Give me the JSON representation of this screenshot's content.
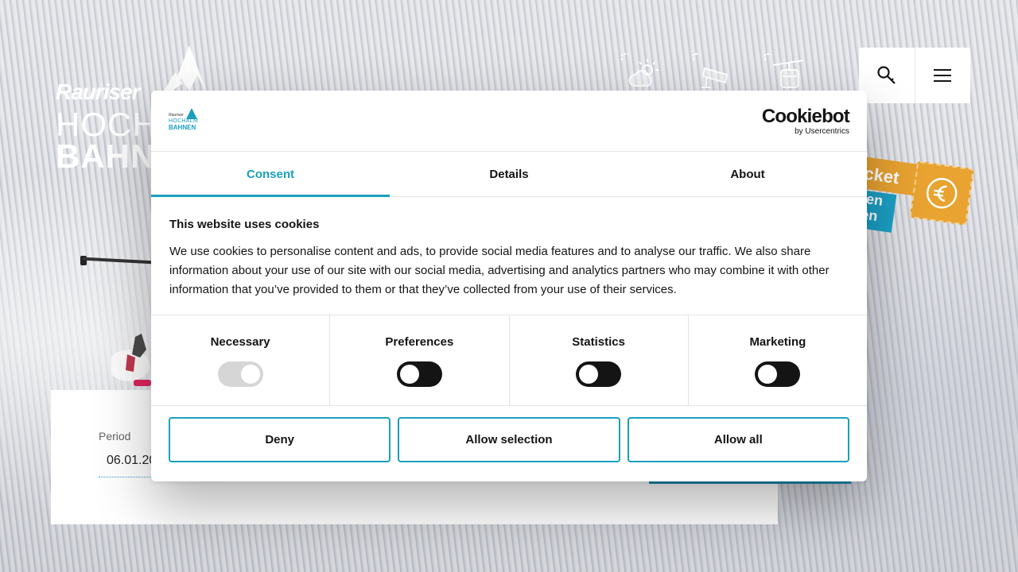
{
  "logo": {
    "line1": "Rauriser",
    "line2": "HOCH",
    "line3": "BAHN"
  },
  "top_icons": [
    "weather-icon",
    "webcam-icon",
    "gondola-icon"
  ],
  "nav": {
    "search_icon": "search-icon",
    "menu_icon": "menu-icon"
  },
  "ticket_badge": {
    "title": "cket",
    "line1": "hen",
    "line2": "ren",
    "icon": "piggy-bank-euro-icon",
    "color": "#e8a331",
    "accent": "#1b9fc4"
  },
  "booking": {
    "period_label": "Period",
    "period_value": "06.01.20"
  },
  "cookie_dialog": {
    "logo": {
      "small": "Rauriser",
      "mid": "HOCHALM",
      "big": "BAHNEN"
    },
    "brand": {
      "name": "Cookiebot",
      "sub": "by Usercentrics"
    },
    "tabs": [
      {
        "label": "Consent",
        "active": true
      },
      {
        "label": "Details",
        "active": false
      },
      {
        "label": "About",
        "active": false
      }
    ],
    "title": "This website uses cookies",
    "text": "We use cookies to personalise content and ads, to provide social media features and to analyse our traffic. We also share information about your use of our site with our social media, advertising and analytics partners who may combine it with other information that you’ve provided to them or that they’ve collected from your use of their services.",
    "toggles": [
      {
        "label": "Necessary",
        "state": "on",
        "disabled": true
      },
      {
        "label": "Preferences",
        "state": "off",
        "disabled": false
      },
      {
        "label": "Statistics",
        "state": "off",
        "disabled": false
      },
      {
        "label": "Marketing",
        "state": "off",
        "disabled": false
      }
    ],
    "buttons": {
      "deny": "Deny",
      "allow_selection": "Allow selection",
      "allow_all": "Allow all"
    },
    "accent_color": "#1a9fc0"
  }
}
